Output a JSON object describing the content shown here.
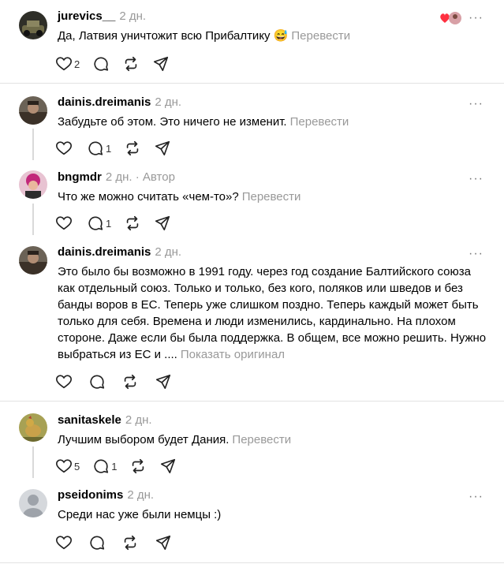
{
  "posts": [
    {
      "username": "jurevics__",
      "time": "2 дн.",
      "text": "Да, Латвия уничтожит всю Прибалтику 😅",
      "translate": "Перевести",
      "likes": "2",
      "avatar_color": "#3a3a2e"
    },
    {
      "username": "dainis.dreimanis",
      "time": "2 дн.",
      "text": "Забудьте об этом. Это ничего не изменит.",
      "translate": "Перевести",
      "replies": "1",
      "avatar_color": "#4a4036"
    },
    {
      "username": "bngmdr",
      "time": "2 дн.",
      "author_badge": "· Автор",
      "text": "Что же можно считать «чем-то»?",
      "translate": "Перевести",
      "replies": "1",
      "avatar_color": "#c23b7a"
    },
    {
      "username": "dainis.dreimanis",
      "time": "2 дн.",
      "text": "Это было бы возможно в 1991 году. через год создание Балтийского союза как отдельный союз. Только и только, без кого, поляков или шведов и без банды воров в ЕС. Теперь уже слишком поздно. Теперь каждый может быть только для себя. Времена и люди изменились, кардинально. На плохом стороне. Даже если бы была поддержка. В общем, все можно решить. Нужно выбраться из ЕС и ....",
      "translate": "Показать оригинал",
      "avatar_color": "#4a4036"
    },
    {
      "username": "sanitaskele",
      "time": "2 дн.",
      "text": "Лучшим выбором будет Дания.",
      "translate": "Перевести",
      "likes": "5",
      "replies": "1",
      "avatar_color": "#8f8a3a"
    },
    {
      "username": "pseidonims",
      "time": "2 дн.",
      "text": "Среди нас уже были немцы :)",
      "avatar_color": "#c8ccd2"
    }
  ],
  "more_label": "···",
  "icons": {
    "like": "heart-icon",
    "reply": "comment-icon",
    "repost": "repost-icon",
    "share": "share-icon",
    "more": "more-icon"
  }
}
